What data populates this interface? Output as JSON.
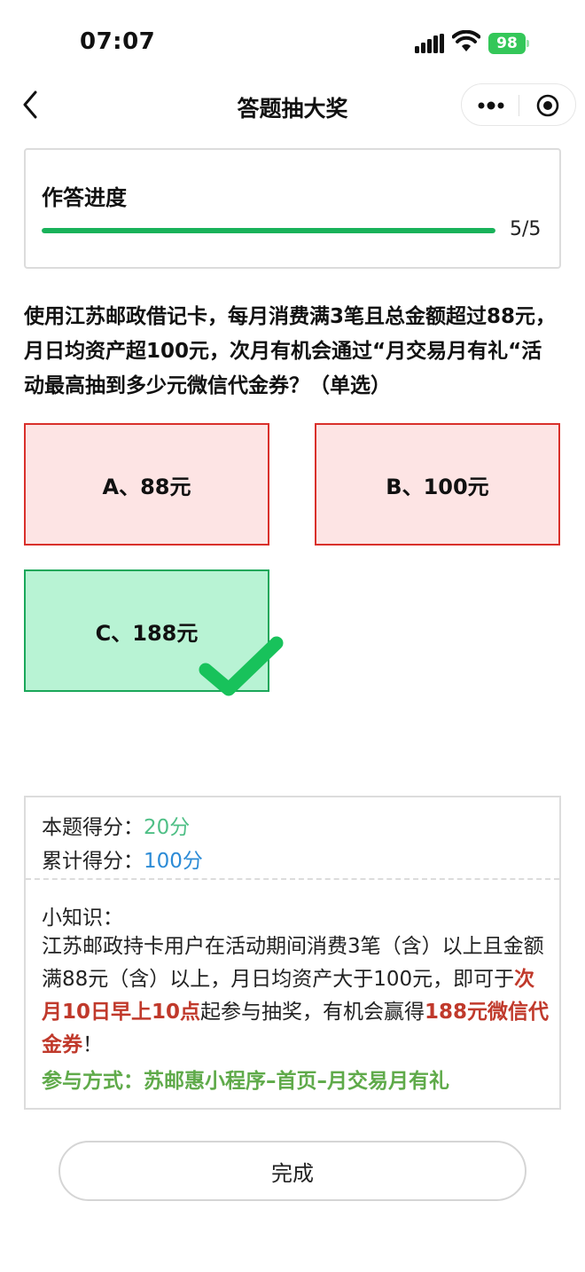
{
  "status_bar": {
    "time": "07:07",
    "battery": "98"
  },
  "nav": {
    "title": "答题抽大奖"
  },
  "progress": {
    "title": "作答进度",
    "count": "5/5",
    "fraction": 1.0
  },
  "question": {
    "text": "使用江苏邮政借记卡，每月消费满3笔且总金额超过88元，月日均资产超100元，次月有机会通过“月交易月有礼“活动最高抽到多少元微信代金券？（单选）"
  },
  "options": [
    {
      "label": "A、88元",
      "state": "wrong"
    },
    {
      "label": "B、100元",
      "state": "wrong"
    },
    {
      "label": "C、188元",
      "state": "correct"
    }
  ],
  "result": {
    "score_label": "本题得分：",
    "score_value": "20分",
    "total_label": "累计得分：",
    "total_value": "100分",
    "tip_title": "小知识：",
    "tip_part1": "江苏邮政持卡用户在活动期间消费3笔（含）以上且金额满88元（含）以上，月日均资产大于100元，即可于",
    "tip_highlight1": "次月10日早上10点",
    "tip_part2": "起参与抽奖，有机会赢得",
    "tip_highlight2": "188元微信代金券",
    "tip_part3": "！",
    "method": "参与方式：苏邮惠小程序–首页–月交易月有礼"
  },
  "footer": {
    "done_label": "完成"
  },
  "colors": {
    "green": "#19b25a",
    "red": "#d9302b",
    "blue": "#2c8bd6"
  }
}
